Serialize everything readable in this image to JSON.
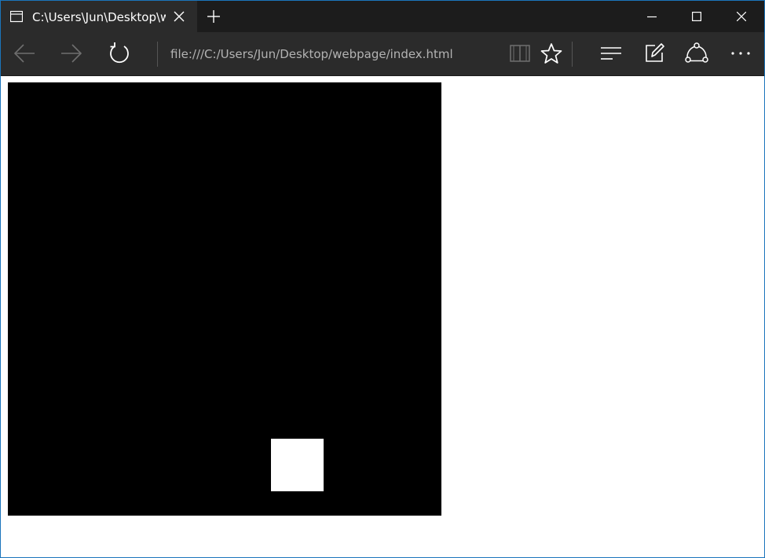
{
  "browser": {
    "tab": {
      "title": "C:\\Users\\Jun\\Desktop\\webpage\\index.html"
    },
    "address_bar": {
      "url": "file:///C:/Users/Jun/Desktop/webpage/index.html"
    },
    "icons": {
      "tab": "tab-page-icon",
      "close_tab": "close-icon",
      "new_tab": "plus-icon",
      "minimize": "minimize-icon",
      "maximize": "maximize-icon",
      "close_window": "close-icon",
      "back": "arrow-left-icon",
      "forward": "arrow-right-icon",
      "refresh": "refresh-icon",
      "reading_view": "book-icon",
      "favorite": "star-icon",
      "hub": "hub-lines-icon",
      "web_note": "pen-note-icon",
      "share": "share-icon",
      "more": "ellipsis-icon"
    },
    "colors": {
      "chrome_dark": "#2b2b2b",
      "titlebar": "#1c1c1c",
      "window_border": "#1b75bc"
    }
  },
  "page": {
    "canvas": {
      "background": "#000000"
    },
    "square": {
      "color": "#ffffff"
    }
  }
}
